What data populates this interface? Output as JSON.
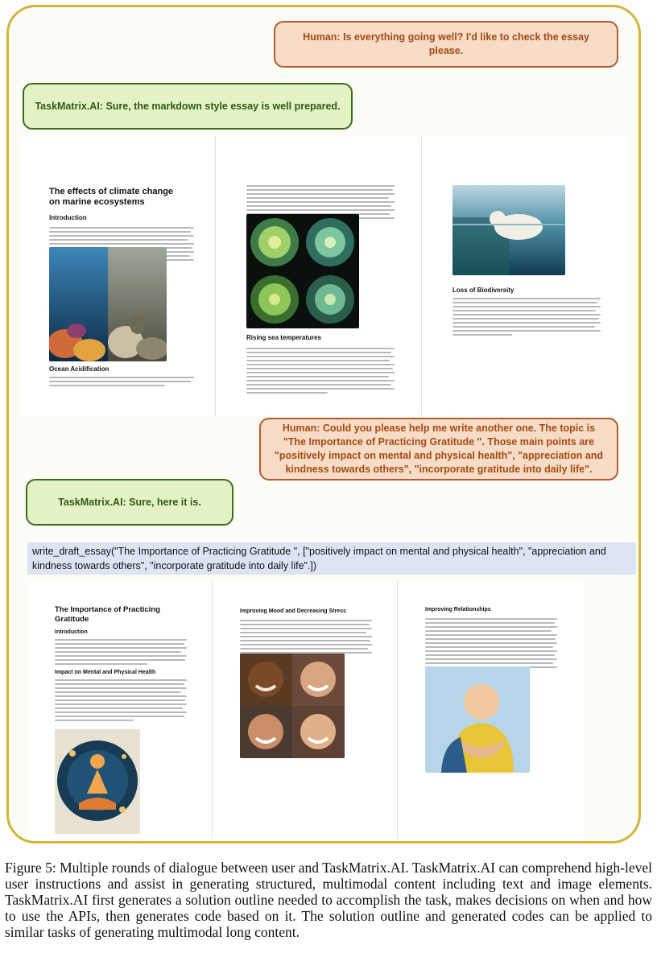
{
  "dialogue": {
    "human_1": "Human: Is everything going well? I'd like to check the essay please.",
    "ai_1": "TaskMatrix.AI: Sure, the markdown style essay is well prepared.",
    "human_2": "Human: Could you please help me write another one. The topic is \"The Importance of Practicing Gratitude \". Those main points are \"positively impact on mental and physical health\", \"appreciation and kindness towards others\", \"incorporate gratitude into daily life\".",
    "ai_2": "TaskMatrix.AI: Sure, here it is."
  },
  "essay1": {
    "title": "The effects of climate change on marine ecosystems",
    "intro_heading": "Introduction",
    "ocean_heading": "Ocean Acidification",
    "sea_heading": "Rising sea temperatures",
    "bio_heading": "Loss of Biodiversity"
  },
  "code_call": "write_draft_essay(\"The Importance of Practicing Gratitude \", [\"positively impact on mental and physical health\", \"appreciation and kindness towards others\", \"incorporate gratitude into daily life\".])",
  "essay2": {
    "title": "The Importance of Practicing Gratitude",
    "intro_heading": "Introduction",
    "impact_heading": "Impact on Mental and Physical Health",
    "mood_heading": "Improving Mood and Decreasing Stress",
    "rel_heading": "Improving Relationships"
  },
  "caption": "Figure 5: Multiple rounds of dialogue between user and TaskMatrix.AI. TaskMatrix.AI can comprehend high-level user instructions and assist in generating structured, multimodal content including text and image elements. TaskMatrix.AI first generates a solution outline needed to accomplish the task, makes decisions on when and how to use the APIs, then generates code based on it. The solution outline and generated codes can be applied to similar tasks of generating multimodal long content.",
  "colors": {
    "frame_border": "#d4b43a",
    "human_fill": "#f7dcc8",
    "human_text": "#a64a10",
    "ai_fill": "#e3f3c6",
    "ai_text": "#2f5a12",
    "code_fill": "#dde5f5"
  }
}
